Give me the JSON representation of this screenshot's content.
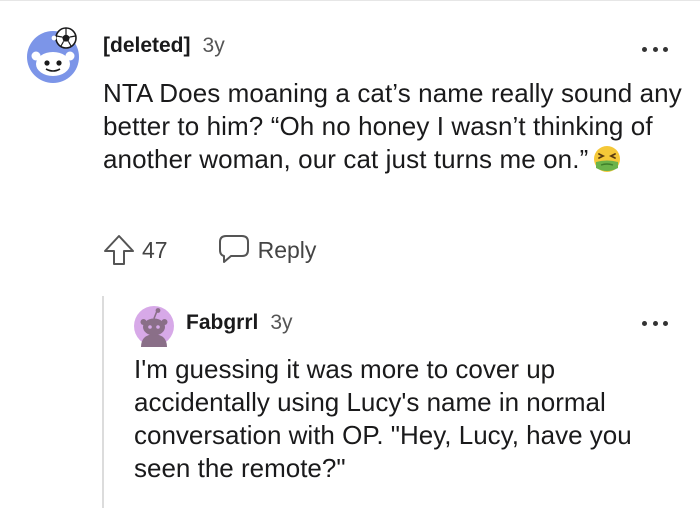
{
  "comment": {
    "username": "[deleted]",
    "age": "3y",
    "avatar_icon": "snoo-soccer-avatar-icon",
    "text": "NTA Does moaning a cat’s name really sound any better to him? “Oh no honey I wasn’t thinking of another woman, our cat just turns me on.”",
    "emoji_icon": "nauseated-face-emoji-icon",
    "upvotes": "47",
    "reply_label": "Reply",
    "more_icon": "more-options-icon"
  },
  "reply": {
    "username": "Fabgrrl",
    "age": "3y",
    "avatar_icon": "snoo-purple-avatar-icon",
    "text": "I'm guessing it was more to cover up accidentally using Lucy's name in normal conversation with OP. \"Hey, Lucy, have you seen the remote?\"",
    "more_icon": "more-options-icon"
  },
  "colors": {
    "text": "#1a1a1b",
    "muted": "#555555",
    "avatar_main_bg": "#7c95e8",
    "avatar_reply_bg": "#d7a9e8",
    "thread_line": "#dcdcdc"
  }
}
